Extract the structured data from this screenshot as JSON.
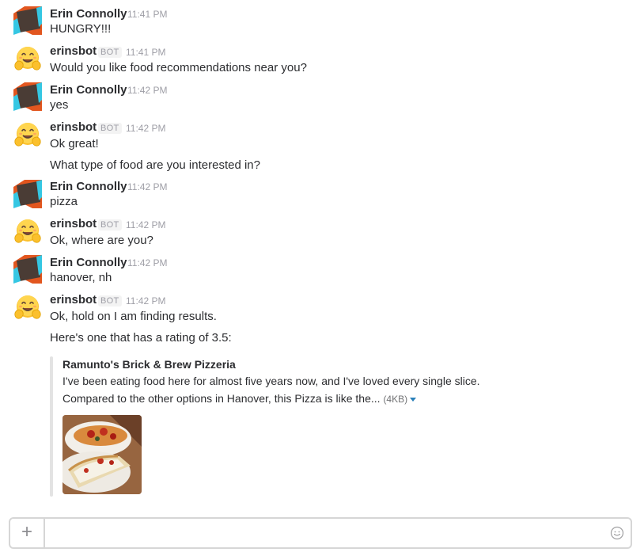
{
  "users": {
    "erin": {
      "name": "Erin Connolly"
    },
    "bot": {
      "name": "erinsbot",
      "badge": "BOT"
    }
  },
  "messages": [
    {
      "sender": "Erin Connolly",
      "time": "11:41 PM",
      "lines": [
        "HUNGRY!!!"
      ]
    },
    {
      "sender": "erinsbot",
      "badge": "BOT",
      "time": "11:41 PM",
      "lines": [
        "Would you like food recommendations near you?"
      ]
    },
    {
      "sender": "Erin Connolly",
      "time": "11:42 PM",
      "lines": [
        "yes"
      ]
    },
    {
      "sender": "erinsbot",
      "badge": "BOT",
      "time": "11:42 PM",
      "lines": [
        "Ok great!",
        "What type of food are you interested in?"
      ]
    },
    {
      "sender": "Erin Connolly",
      "time": "11:42 PM",
      "lines": [
        "pizza"
      ]
    },
    {
      "sender": "erinsbot",
      "badge": "BOT",
      "time": "11:42 PM",
      "lines": [
        "Ok, where are you?"
      ]
    },
    {
      "sender": "Erin Connolly",
      "time": "11:42 PM",
      "lines": [
        "hanover, nh"
      ]
    },
    {
      "sender": "erinsbot",
      "badge": "BOT",
      "time": "11:42 PM",
      "lines": [
        "Ok, hold on I am finding results.",
        "Here's one that has a rating of 3.5:"
      ]
    }
  ],
  "attachment": {
    "title": "Ramunto's Brick & Brew Pizzeria",
    "line1": "I've been eating food here for almost five years now, and I've loved every single slice.",
    "line2": "Compared to the other options in Hanover, this Pizza is like the...",
    "filesize": "(4KB)",
    "image": "pizza-photo"
  },
  "composer": {
    "placeholder": "",
    "plus_icon": "plus-icon",
    "emoji_icon": "smiley-icon"
  },
  "colors": {
    "erin_avatar_orange": "#e2561f",
    "erin_avatar_cyan": "#35c7e3",
    "erin_avatar_dark": "#4a3c35",
    "link_blue": "#2a80b9"
  }
}
